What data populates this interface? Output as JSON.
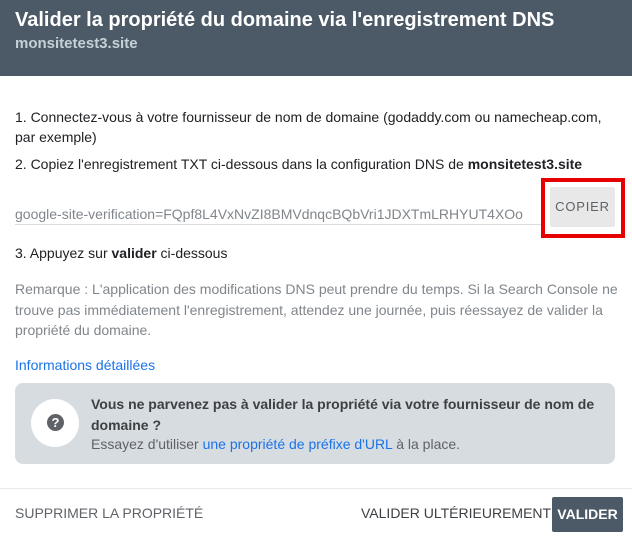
{
  "dialog": {
    "title": "Valider la propriété du domaine via l'enregistrement DNS",
    "domain": "monsitetest3.site"
  },
  "steps": {
    "step1": "1. Connectez-vous à votre fournisseur de nom de domaine (godaddy.com ou namecheap.com, par exemple)",
    "step2_prefix": "2. Copiez l'enregistrement TXT ci-dessous dans la configuration DNS de ",
    "step2_domain": "monsitetest3.site",
    "step3_prefix": "3. Appuyez sur ",
    "step3_bold": "valider",
    "step3_suffix": " ci-dessous"
  },
  "txt_record": "google-site-verification=FQpf8L4VxNvZI8BMVdnqcBQbVri1JDXTmLRHYUT4XOo",
  "copy_button": {
    "label": "COPIER",
    "highlight_color": "#e60000"
  },
  "note": "Remarque : L'application des modifications DNS peut prendre du temps. Si la Search Console ne trouve pas immédiatement l'enregistrement, attendez une journée, puis réessayez de valider la propriété du domaine.",
  "info_link": "Informations détaillées",
  "help": {
    "icon": "help-question-icon",
    "title": "Vous ne parvenez pas à valider la propriété via votre fournisseur de nom de domaine ?",
    "text_prefix": "Essayez d'utiliser ",
    "link": "une propriété de préfixe d'URL",
    "text_suffix": " à la place."
  },
  "footer": {
    "delete_label": "SUPPRIMER LA PROPRIÉTÉ",
    "later_label": "VALIDER ULTÉRIEUREMENT",
    "validate_label": "VALIDER"
  },
  "colors": {
    "header_bg": "#4b5a66",
    "link": "#1a73e8",
    "help_box_bg": "#d7dce1",
    "primary_button": "#4b5a66"
  }
}
